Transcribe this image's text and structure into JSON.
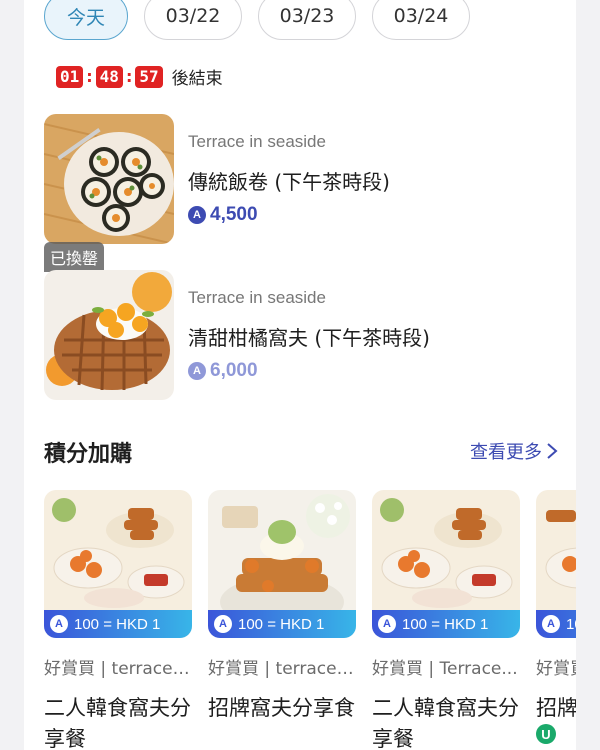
{
  "date_tabs": [
    "今天",
    "03/22",
    "03/23",
    "03/24"
  ],
  "countdown": {
    "hours": "01",
    "minutes": "48",
    "seconds": "57",
    "suffix": "後結束"
  },
  "rewards": [
    {
      "merchant": "Terrace in seaside",
      "title": "傳統飯卷 (下午茶時段)",
      "points": "4,500",
      "redeemed": ""
    },
    {
      "merchant": "Terrace in seaside",
      "title": "清甜柑橘窩夫 (下午茶時段)",
      "points": "6,000",
      "redeemed": "已換罄"
    }
  ],
  "points_icon_glyph": "A",
  "section": {
    "title": "積分加購",
    "view_more": "查看更多"
  },
  "cards": [
    {
      "badge": "100 = HKD 1",
      "merchant": "好賞買 | terrace ...",
      "title": "二人韓食窩夫分享餐"
    },
    {
      "badge": "100 = HKD 1",
      "merchant": "好賞買 | terrace ...",
      "title": "招牌窩夫分享食"
    },
    {
      "badge": "100 = HKD 1",
      "merchant": "好賞買 | Terrace...",
      "title": "二人韓食窩夫分享餐"
    },
    {
      "badge": "10",
      "merchant": "好賞買",
      "title": "招牌食"
    }
  ],
  "watermark": "U",
  "colors": {
    "accent": "#3d4bb2",
    "countdown": "#e02323",
    "active_tab": "#2f86b5"
  }
}
